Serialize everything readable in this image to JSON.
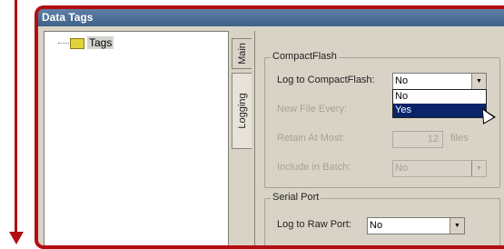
{
  "window": {
    "title": "Data Tags"
  },
  "tree": {
    "root_label": "Tags"
  },
  "tabs": [
    {
      "label": "Main"
    },
    {
      "label": "Logging"
    }
  ],
  "compact_flash": {
    "group_title": "CompactFlash",
    "log_label": "Log to CompactFlash:",
    "log_value": "No",
    "log_options": [
      "No",
      "Yes"
    ],
    "log_highlighted": "Yes",
    "new_file_label": "New File Every:",
    "retain_label": "Retain At Most:",
    "retain_value": "12",
    "retain_unit": "files",
    "batch_label": "Include in Batch:",
    "batch_value": "No"
  },
  "serial_port": {
    "group_title": "Serial Port",
    "raw_label": "Log to Raw Port:",
    "raw_value": "No"
  },
  "colors": {
    "annotation_red": "#b40e12",
    "selection_blue": "#0a246a",
    "panel_bg": "#d9d3c7"
  },
  "icons": {
    "arrow": "down-arrow-annotation",
    "tag": "tag-icon",
    "dropdown": "chevron-down-icon",
    "cursor": "mouse-pointer-icon"
  }
}
